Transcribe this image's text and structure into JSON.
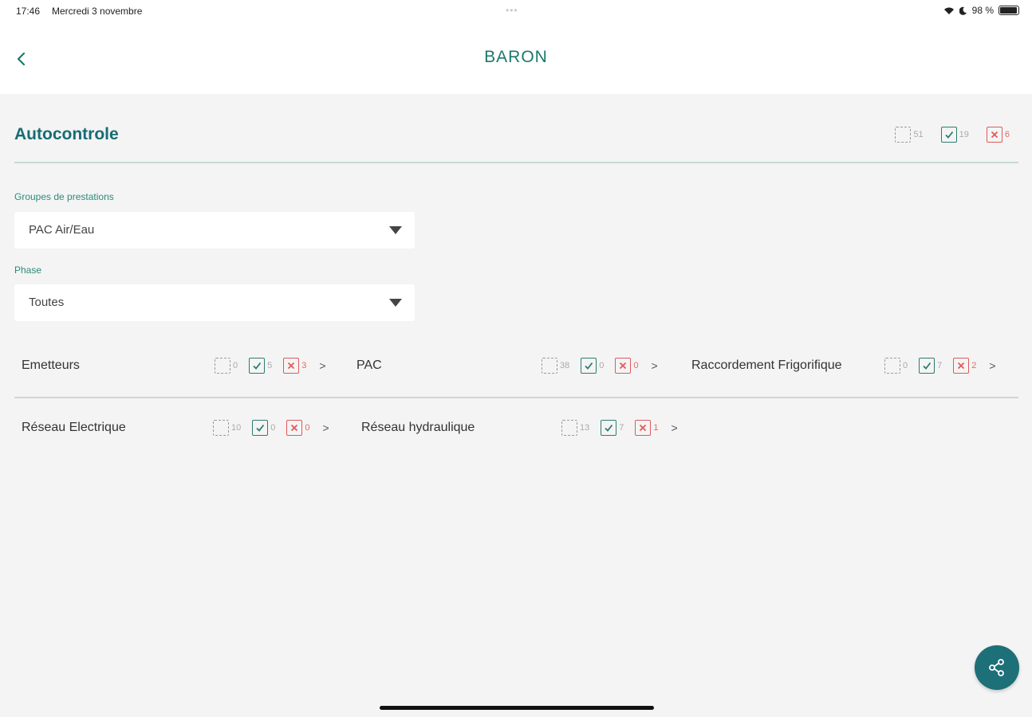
{
  "status": {
    "time": "17:46",
    "date": "Mercredi 3 novembre",
    "battery": "98 %",
    "dots": "•••"
  },
  "nav": {
    "title": "BARON",
    "back_icon": "chevron-left-icon"
  },
  "section": {
    "title": "Autocontrole"
  },
  "summary": {
    "pending": "51",
    "ok": "19",
    "ko": "6"
  },
  "filters": {
    "group_label": "Groupes de prestations",
    "group_value": "PAC Air/Eau",
    "phase_label": "Phase",
    "phase_value": "Toutes"
  },
  "categories": [
    {
      "label": "Emetteurs",
      "pending": "0",
      "ok": "5",
      "ko": "3"
    },
    {
      "label": "PAC",
      "pending": "38",
      "ok": "0",
      "ko": "0"
    },
    {
      "label": "Raccordement Frigorifique",
      "pending": "0",
      "ok": "7",
      "ko": "2"
    },
    {
      "label": "Réseau Electrique",
      "pending": "10",
      "ok": "0",
      "ko": "0"
    },
    {
      "label": "Réseau hydraulique",
      "pending": "13",
      "ok": "7",
      "ko": "1"
    }
  ],
  "colors": {
    "accent": "#176c73",
    "ok": "#2b7d6e",
    "ko": "#e05a5a",
    "fab": "#1d6f78"
  },
  "fab": {
    "icon": "share-icon"
  },
  "chevron": ">"
}
